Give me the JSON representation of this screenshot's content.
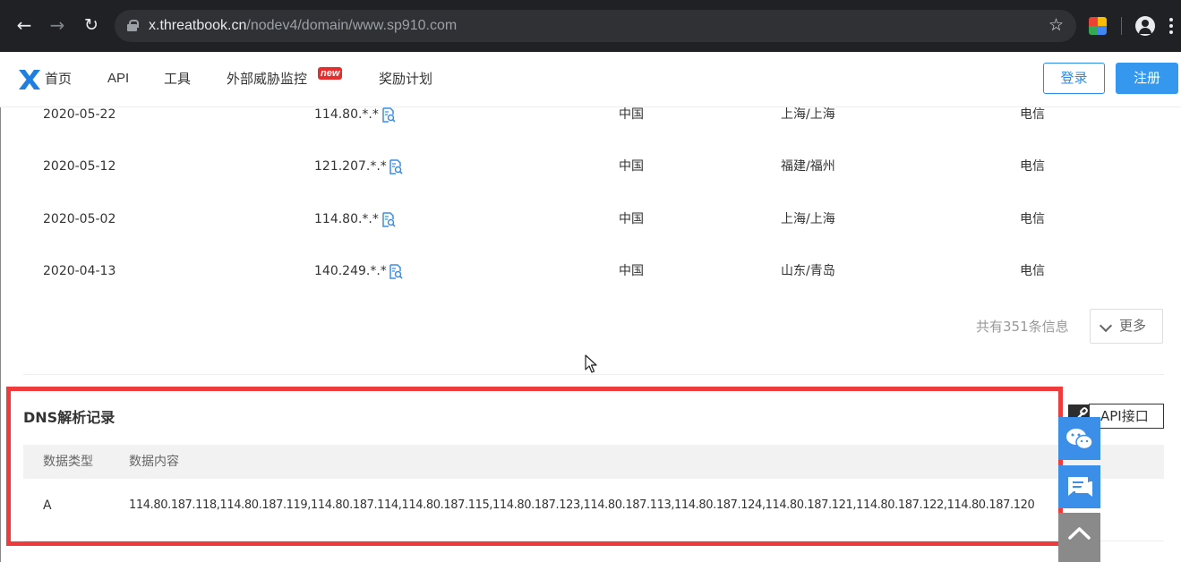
{
  "browser": {
    "url_host": "x.threatbook.cn",
    "url_path": "/nodev4/domain/www.sp910.com"
  },
  "header": {
    "nav": [
      {
        "label": "首页"
      },
      {
        "label": "API"
      },
      {
        "label": "工具"
      },
      {
        "label": "外部威胁监控"
      },
      {
        "label": "奖励计划"
      }
    ],
    "new_badge": "new",
    "login_label": "登录",
    "register_label": "注册"
  },
  "ip_history": {
    "rows": [
      {
        "date": "2020-05-22",
        "ip": "114.80.*.*",
        "country": "中国",
        "location": "上海/上海",
        "isp": "电信"
      },
      {
        "date": "2020-05-12",
        "ip": "121.207.*.*",
        "country": "中国",
        "location": "福建/福州",
        "isp": "电信"
      },
      {
        "date": "2020-05-02",
        "ip": "114.80.*.*",
        "country": "中国",
        "location": "上海/上海",
        "isp": "电信"
      },
      {
        "date": "2020-04-13",
        "ip": "140.249.*.*",
        "country": "中国",
        "location": "山东/青岛",
        "isp": "电信"
      }
    ],
    "total_label": "共有351条信息",
    "more_label": "更多"
  },
  "dns": {
    "title": "DNS解析记录",
    "api_label": "API接口",
    "columns": [
      "数据类型",
      "数据内容"
    ],
    "rows": [
      {
        "type": "A",
        "content": "114.80.187.118,114.80.187.119,114.80.187.114,114.80.187.115,114.80.187.123,114.80.187.113,114.80.187.124,114.80.187.121,114.80.187.122,114.80.187.120"
      }
    ]
  },
  "colors": {
    "accent": "#3597ee",
    "highlight": "#ef3b3b",
    "badge": "#e62e2e"
  }
}
